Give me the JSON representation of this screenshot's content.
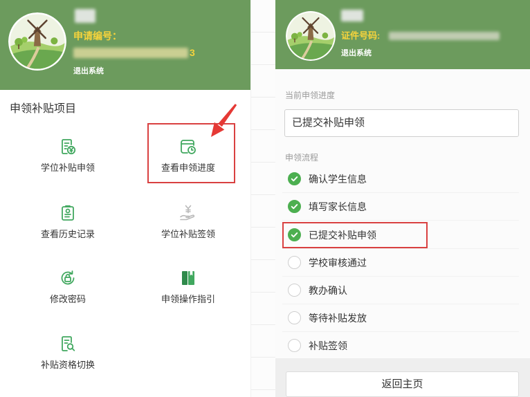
{
  "left_panel": {
    "header": {
      "id_label": "申请编号：",
      "id_tail": "3",
      "logout_label": "退出系统"
    },
    "section_title": "申领补贴项目",
    "menu": [
      {
        "label": "学位补贴申领",
        "icon": "document-yen-icon"
      },
      {
        "label": "查看申领进度",
        "icon": "calendar-clock-icon"
      },
      {
        "label": "查看历史记录",
        "icon": "clipboard-icon"
      },
      {
        "label": "学位补贴签领",
        "icon": "hand-yen-icon"
      },
      {
        "label": "修改密码",
        "icon": "lock-reset-icon"
      },
      {
        "label": "申领操作指引",
        "icon": "book-icon"
      },
      {
        "label": "补贴资格切换",
        "icon": "document-search-icon"
      }
    ]
  },
  "right_panel": {
    "header": {
      "id_label": "证件号码:",
      "logout_label": "退出系统"
    },
    "progress_label": "当前申领进度",
    "progress_value": "已提交补贴申领",
    "steps_label": "申领流程",
    "steps": [
      {
        "label": "确认学生信息",
        "done": true
      },
      {
        "label": "填写家长信息",
        "done": true
      },
      {
        "label": "已提交补贴申领",
        "done": true
      },
      {
        "label": "学校审核通过",
        "done": false
      },
      {
        "label": "教办确认",
        "done": false
      },
      {
        "label": "等待补贴发放",
        "done": false
      },
      {
        "label": "补贴签领",
        "done": false
      }
    ],
    "back_button": "返回主页"
  },
  "colors": {
    "header_green": "#6c9b5d",
    "id_label_yellow": "#f6d33c",
    "icon_green": "#41a85f",
    "check_green": "#4caf50",
    "highlight_red": "#d94040"
  }
}
